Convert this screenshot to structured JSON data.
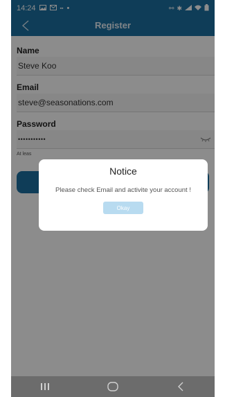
{
  "status_bar": {
    "time": "14:24",
    "icons": [
      "gallery-icon",
      "mail-icon",
      "carrier-icon",
      "dot-icon"
    ],
    "right_icons": [
      "link-icon",
      "bluetooth-icon",
      "signal-icon",
      "wifi-icon",
      "battery-icon"
    ]
  },
  "app_bar": {
    "title": "Register",
    "back_icon": "chevron-left-icon"
  },
  "form": {
    "name_label": "Name",
    "name_value": "Steve Koo",
    "email_label": "Email",
    "email_value": "steve@seasonations.com",
    "password_label": "Password",
    "password_value": "•••••••••••",
    "password_hint": "At leas"
  },
  "dialog": {
    "title": "Notice",
    "message": "Please check Email and activite your account !",
    "okay_label": "Okay"
  },
  "colors": {
    "primary": "#1c6fa0",
    "okay_button": "#b8dbf0",
    "nav_bar": "#6c6c6c"
  }
}
